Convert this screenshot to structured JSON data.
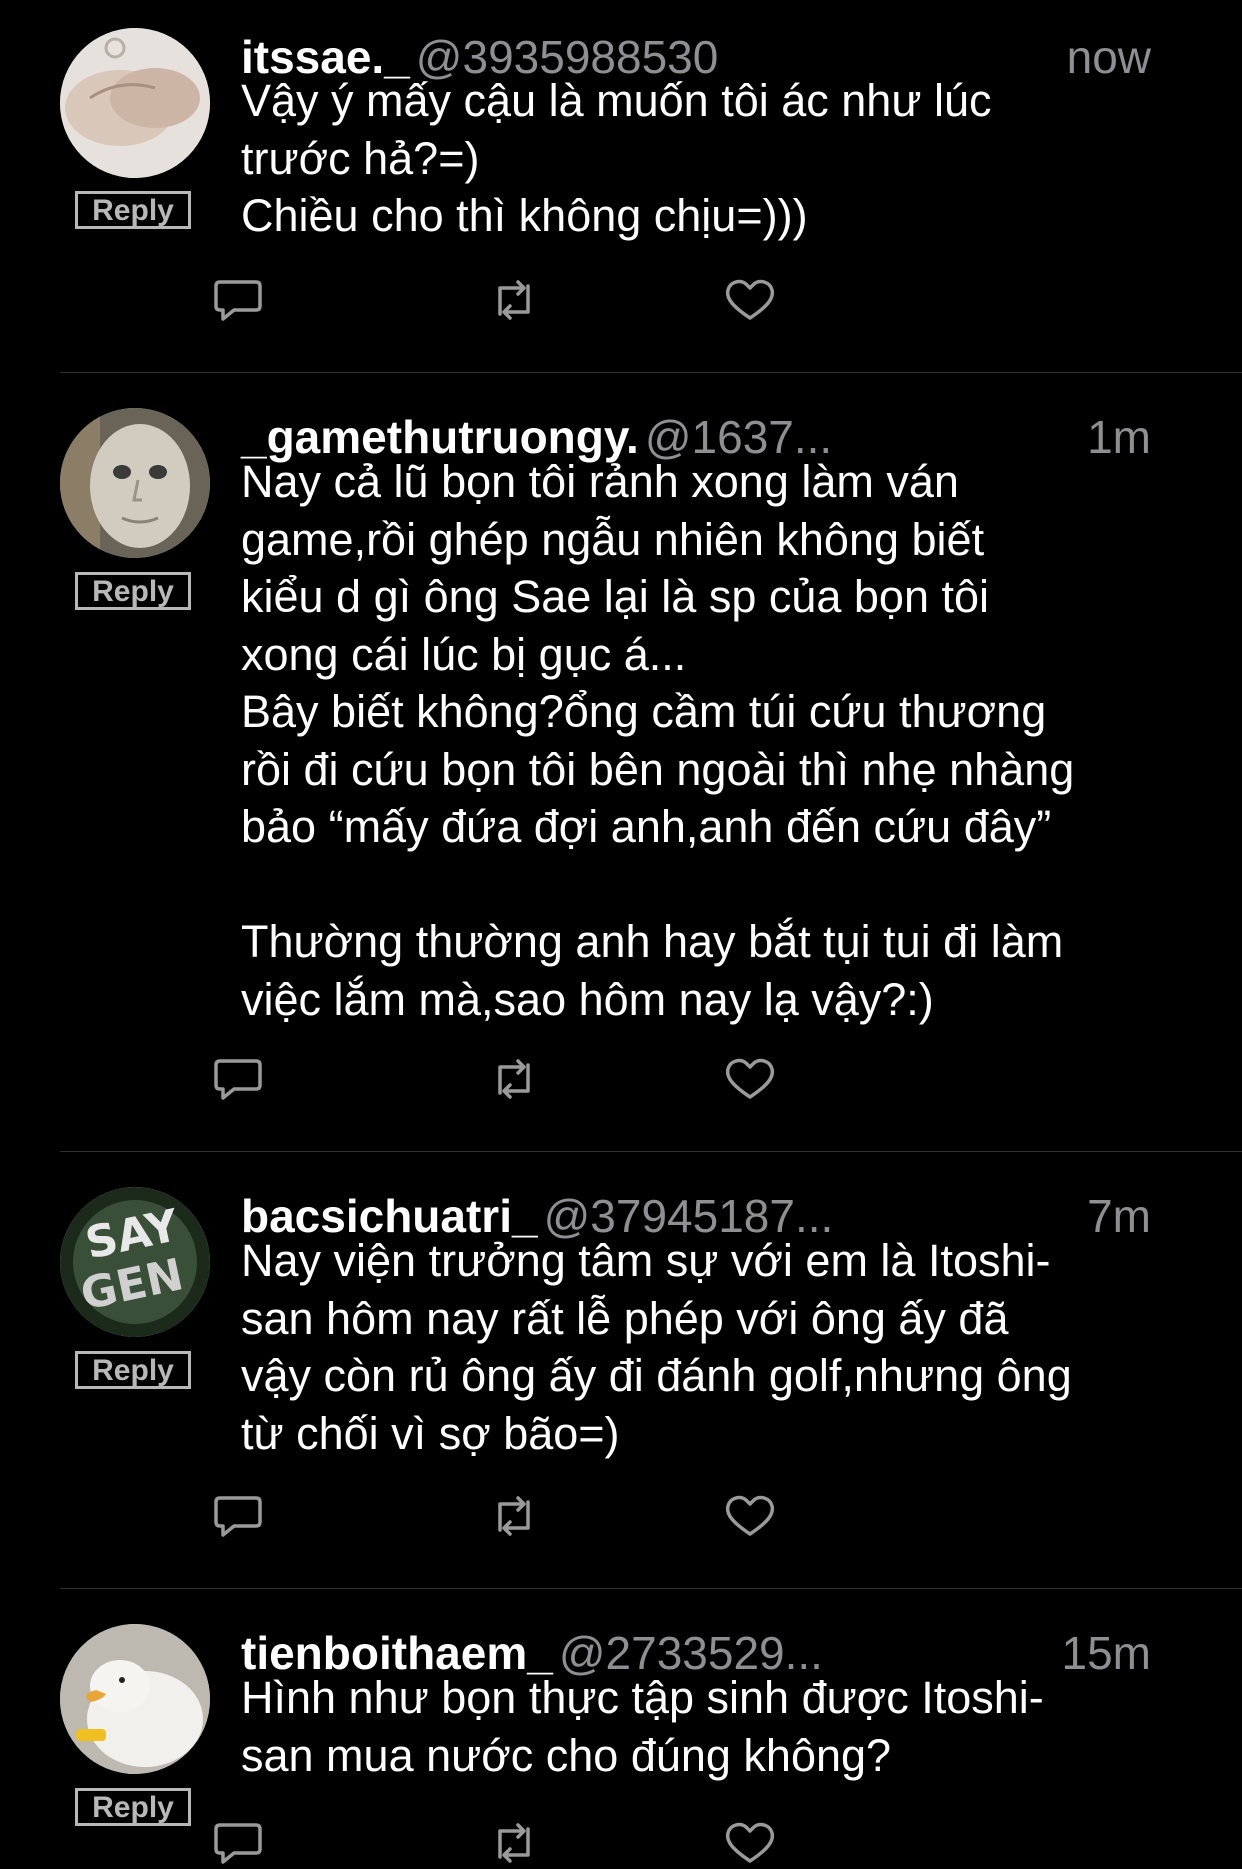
{
  "tweets": [
    {
      "display_name": "itssae._",
      "handle": "@3935988530",
      "time": "now",
      "reply_label": "Reply",
      "text": "Vậy ý mấy cậu là muốn tôi ác như lúc\ntrước hả?=)\nChiều cho thì không chịu=)))"
    },
    {
      "display_name": "_gamethutruongy.",
      "handle": "@1637...",
      "time": "1m",
      "reply_label": "Reply",
      "text": "Nay cả lũ bọn tôi rảnh xong làm ván\ngame,rồi ghép ngẫu nhiên không biết\nkiểu d gì ông Sae lại là sp của bọn tôi\nxong cái lúc bị gục á...\nBây biết không?ổng cầm túi cứu thương\nrồi đi cứu bọn tôi bên ngoài thì nhẹ nhàng\nbảo “mấy đứa đợi anh,anh đến cứu đây”\n\nThường thường anh hay bắt tụi tui đi làm\nviệc lắm mà,sao hôm nay lạ vậy?:)"
    },
    {
      "display_name": "bacsichuatri_",
      "handle": "@37945187...",
      "time": "7m",
      "reply_label": "Reply",
      "text": "Nay viện trưởng tâm sự với em là Itoshi-\nsan hôm nay rất lễ phép với ông ấy đã\nvậy còn rủ ông ấy đi đánh golf,nhưng ông\ntừ chối vì sợ bão=)"
    },
    {
      "display_name": "tienboithaem_",
      "handle": "@2733529...",
      "time": "15m",
      "reply_label": "Reply",
      "text": "Hình như bọn thực tập sinh được Itoshi-\nsan mua nước cho đúng không?"
    }
  ],
  "icons": {
    "reply": "comment-bubble-icon",
    "retweet": "retweet-icon",
    "like": "heart-icon"
  },
  "colors": {
    "background": "#000000",
    "text": "#ffffff",
    "secondary": "#8e8e93",
    "icon": "#9a9a9a",
    "separator": "#2e2e2e"
  }
}
